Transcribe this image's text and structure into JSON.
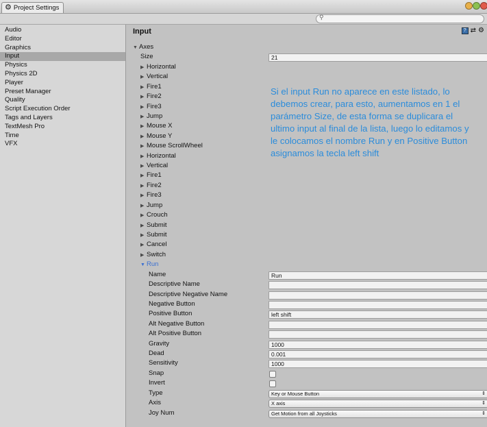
{
  "window": {
    "tab_title": "Project Settings",
    "controls": [
      "#e8b04a",
      "#8cc152",
      "#e05a4a"
    ]
  },
  "toolbar": {
    "search_placeholder": ""
  },
  "sidebar": {
    "items": [
      "Audio",
      "Editor",
      "Graphics",
      "Input",
      "Physics",
      "Physics 2D",
      "Player",
      "Preset Manager",
      "Quality",
      "Script Execution Order",
      "Tags and Layers",
      "TextMesh Pro",
      "Time",
      "VFX"
    ],
    "active": "Input"
  },
  "main": {
    "title": "Input",
    "header_icons": [
      "help-icon",
      "preset-icon",
      "settings-icon"
    ],
    "axes_label": "Axes",
    "size_label": "Size",
    "size_value": "21",
    "axes": [
      "Horizontal",
      "Vertical",
      "Fire1",
      "Fire2",
      "Fire3",
      "Jump",
      "Mouse X",
      "Mouse Y",
      "Mouse ScrollWheel",
      "Horizontal",
      "Vertical",
      "Fire1",
      "Fire2",
      "Fire3",
      "Jump",
      "Crouch",
      "Submit",
      "Submit",
      "Cancel",
      "Switch"
    ],
    "run": {
      "label": "Run",
      "fields": [
        {
          "label": "Name",
          "value": "Run"
        },
        {
          "label": "Descriptive Name",
          "value": ""
        },
        {
          "label": "Descriptive Negative Name",
          "value": ""
        },
        {
          "label": "Negative Button",
          "value": ""
        },
        {
          "label": "Positive Button",
          "value": "left shift"
        },
        {
          "label": "Alt Negative Button",
          "value": ""
        },
        {
          "label": "Alt Positive Button",
          "value": ""
        },
        {
          "label": "Gravity",
          "value": "1000"
        },
        {
          "label": "Dead",
          "value": "0.001"
        },
        {
          "label": "Sensitivity",
          "value": "1000"
        }
      ],
      "snap_label": "Snap",
      "snap": false,
      "invert_label": "Invert",
      "invert": false,
      "type_label": "Type",
      "type_value": "Key or Mouse Button",
      "axis_label": "Axis",
      "axis_value": "X axis",
      "joy_label": "Joy Num",
      "joy_value": "Get Motion from all Joysticks"
    }
  },
  "annotation": "Si el input Run no aparece en este listado, lo debemos crear, para esto, aumentamos en 1 el parámetro Size, de esta forma se duplicara el ultimo input al final de la lista, luego lo editamos y le colocamos el nombre Run y en Positive Button asignamos la tecla left shift",
  "colors": {
    "annotation": "#2b8cdb",
    "selected_row": "#a8a8a8",
    "run_label": "#3a6fd1"
  }
}
